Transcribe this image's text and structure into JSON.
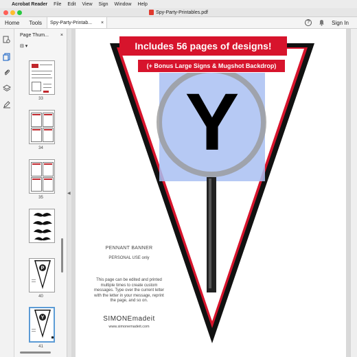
{
  "menubar": {
    "apple": "",
    "app": "Acrobat Reader",
    "items": [
      "File",
      "Edit",
      "View",
      "Sign",
      "Window",
      "Help"
    ]
  },
  "window": {
    "title": "Spy-Party-Printables.pdf"
  },
  "apptabs": {
    "home": "Home",
    "tools": "Tools",
    "doc": "Spy-Party-Printab...",
    "close": "×",
    "help": "?",
    "sign_in": "Sign In"
  },
  "thumbs": {
    "header": "Page Thum...",
    "close": "×",
    "option": "⊟ ▾",
    "pages": [
      "33",
      "34",
      "35",
      "",
      "40",
      "41"
    ]
  },
  "document": {
    "banner_main": "Includes 56 pages of designs!",
    "banner_sub": "(+ Bonus Large Signs & Mugshot Backdrop)",
    "letter": "Y",
    "pennant_title": "PENNANT BANNER",
    "personal_use": "PERSONAL USE only",
    "instructions": "This page can be edited and printed multiple times to create custom messages. Type over the current letter with the letter in your message, reprint the page, and so on.",
    "brand": "SIMONEmadeit",
    "site": "www.simonemadeit.com"
  },
  "colors": {
    "accent_red": "#d7142c",
    "magnifier": "#a9bff2",
    "selection": "#5b9bd5"
  }
}
